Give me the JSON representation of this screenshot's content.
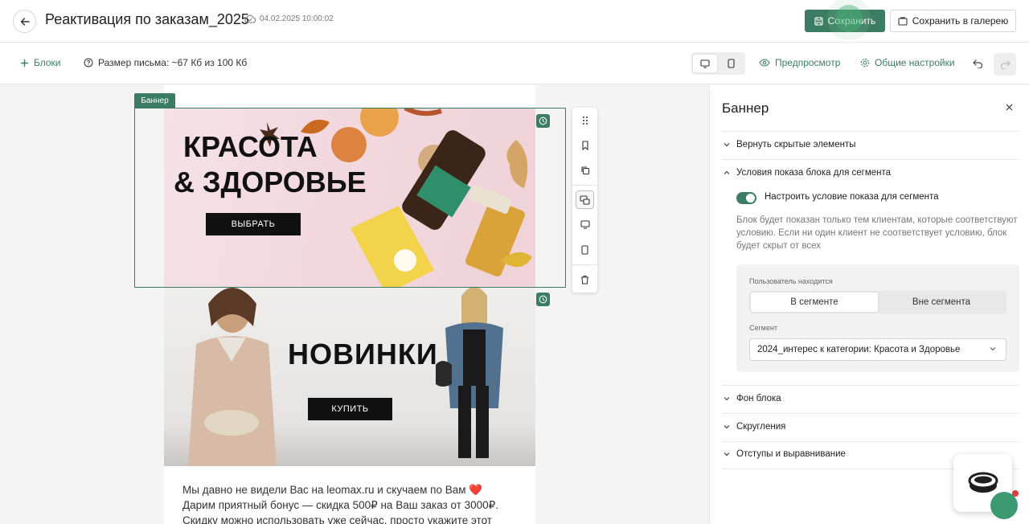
{
  "header": {
    "title": "Реактивация по заказам_2025",
    "saved_at": "04.02.2025 10:00:02",
    "save_label": "Сохранить",
    "gallery_label": "Сохранить в галерею"
  },
  "toolbar": {
    "blocks_label": "Блоки",
    "size_label": "Размер письма: ~67 Кб из 100 Кб",
    "preview_label": "Предпросмотр",
    "settings_label": "Общие настройки"
  },
  "canvas": {
    "selected_tag": "Баннер",
    "banner1": {
      "line1": "КРАСОТА",
      "line2": "& ЗДОРОВЬЕ",
      "button": "ВЫБРАТЬ"
    },
    "banner2": {
      "title": "НОВИНКИ",
      "button": "КУПИТЬ"
    },
    "body_text": "Мы давно не видели Вас на leomax.ru и скучаем по Вам ❤️ Дарим приятный бонус — скидка 500₽ на Ваш заказ от 3000₽. Скидку можно использовать уже сейчас, просто укажите этот промокод при"
  },
  "panel": {
    "title": "Баннер",
    "sections": [
      "Вернуть скрытые элементы",
      "Условия показа блока для сегмента",
      "Фон блока",
      "Скругления",
      "Отступы и выравнивание"
    ],
    "toggle_label": "Настроить условие показа для сегмента",
    "toggle_on": true,
    "description": "Блок будет показан только тем клиентам, которые соответствуют условию. Если ни один клиент не соответствует условию, блок будет скрыт от всех",
    "user_location_label": "Пользователь находится",
    "in_segment": "В сегменте",
    "out_segment": "Вне сегмента",
    "segment_label": "Сегмент",
    "segment_value": "2024_интерес к категории: Красота и Здоровье"
  },
  "colors": {
    "accent": "#3b7d62",
    "notification": "#e23b3b"
  }
}
